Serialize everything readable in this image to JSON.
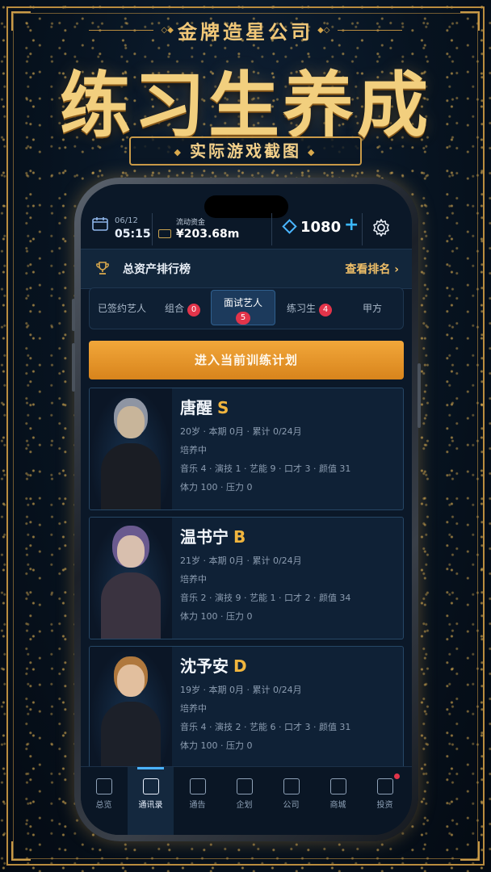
{
  "poster": {
    "subtitle": "金牌造星公司",
    "title": "练习生养成",
    "badge": "实际游戏截图"
  },
  "status_bar": {
    "date": "06/12",
    "time": "05:15",
    "cash_label": "流动资金",
    "cash_value": "¥203.68m",
    "diamonds": "1080",
    "plus": "+"
  },
  "ranking": {
    "title": "总资产排行榜",
    "link": "查看排名 ›"
  },
  "tabs": [
    {
      "label": "已签约艺人",
      "badge": ""
    },
    {
      "label": "组合",
      "badge": "0"
    },
    {
      "label": "面试艺人",
      "badge": "5"
    },
    {
      "label": "练习生",
      "badge": "4"
    },
    {
      "label": "甲方",
      "badge": ""
    }
  ],
  "train_button": "进入当前训练计划",
  "trainees": [
    {
      "name": "唐醒",
      "grade": "S",
      "line1": "20岁 · 本期 0月 · 累计 0/24月",
      "line2": "培养中",
      "line3": "音乐 4 · 演技 1 · 艺能 9 · 口才 3 · 颜值 31",
      "line4": "体力 100 · 压力 0"
    },
    {
      "name": "温书宁",
      "grade": "B",
      "line1": "21岁 · 本期 0月 · 累计 0/24月",
      "line2": "培养中",
      "line3": "音乐 2 · 演技 9 · 艺能 1 · 口才 2 · 颜值 34",
      "line4": "体力 100 · 压力 0"
    },
    {
      "name": "沈予安",
      "grade": "D",
      "line1": "19岁 · 本期 0月 · 累计 0/24月",
      "line2": "培养中",
      "line3": "音乐 4 · 演技 2 · 艺能 6 · 口才 3 · 颜值 31",
      "line4": "体力 100 · 压力 0"
    }
  ],
  "tabbar": [
    {
      "label": "总览",
      "icon": "grid-icon"
    },
    {
      "label": "通讯录",
      "icon": "contacts-icon"
    },
    {
      "label": "通告",
      "icon": "clapper-icon"
    },
    {
      "label": "企划",
      "icon": "clipboard-icon"
    },
    {
      "label": "公司",
      "icon": "building-icon"
    },
    {
      "label": "商城",
      "icon": "bag-icon"
    },
    {
      "label": "投资",
      "icon": "chart-icon"
    }
  ],
  "colors": {
    "accent_gold": "#f0b53e",
    "accent_blue": "#4bb3ff",
    "badge_red": "#e2344a",
    "button_orange": "#f2a73a"
  }
}
